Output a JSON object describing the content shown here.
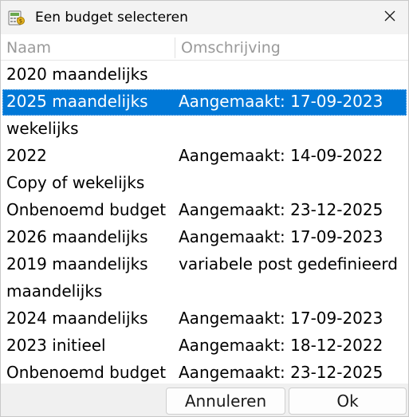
{
  "window": {
    "title": "Een budget selecteren"
  },
  "list": {
    "columns": {
      "name": "Naam",
      "description": "Omschrijving"
    },
    "rows": [
      {
        "name": "2020 maandelijks",
        "description": "",
        "selected": false
      },
      {
        "name": "2025 maandelijks",
        "description": "Aangemaakt: 17-09-2023",
        "selected": true
      },
      {
        "name": "wekelijks",
        "description": "",
        "selected": false
      },
      {
        "name": "2022",
        "description": "Aangemaakt: 14-09-2022",
        "selected": false
      },
      {
        "name": "Copy of wekelijks",
        "description": "",
        "selected": false
      },
      {
        "name": "Onbenoemd budget",
        "description": "Aangemaakt: 23-12-2025",
        "selected": false
      },
      {
        "name": "2026 maandelijks",
        "description": "Aangemaakt: 17-09-2023",
        "selected": false
      },
      {
        "name": "2019 maandelijks",
        "description": "variabele post gedefinieerd",
        "selected": false
      },
      {
        "name": "maandelijks",
        "description": "",
        "selected": false
      },
      {
        "name": "2024 maandelijks",
        "description": "Aangemaakt: 17-09-2023",
        "selected": false
      },
      {
        "name": "2023 initieel",
        "description": "Aangemaakt: 18-12-2022",
        "selected": false
      },
      {
        "name": "Onbenoemd budget",
        "description": "Aangemaakt: 23-12-2025",
        "selected": false
      }
    ]
  },
  "buttons": {
    "cancel": "Annuleren",
    "ok": "Ok"
  },
  "colors": {
    "selection": "#0078d7",
    "titlebar": "#f3f3f3",
    "header_text": "#9a9a9a"
  },
  "icons": {
    "app": "budget-app-icon",
    "close": "close-icon"
  }
}
